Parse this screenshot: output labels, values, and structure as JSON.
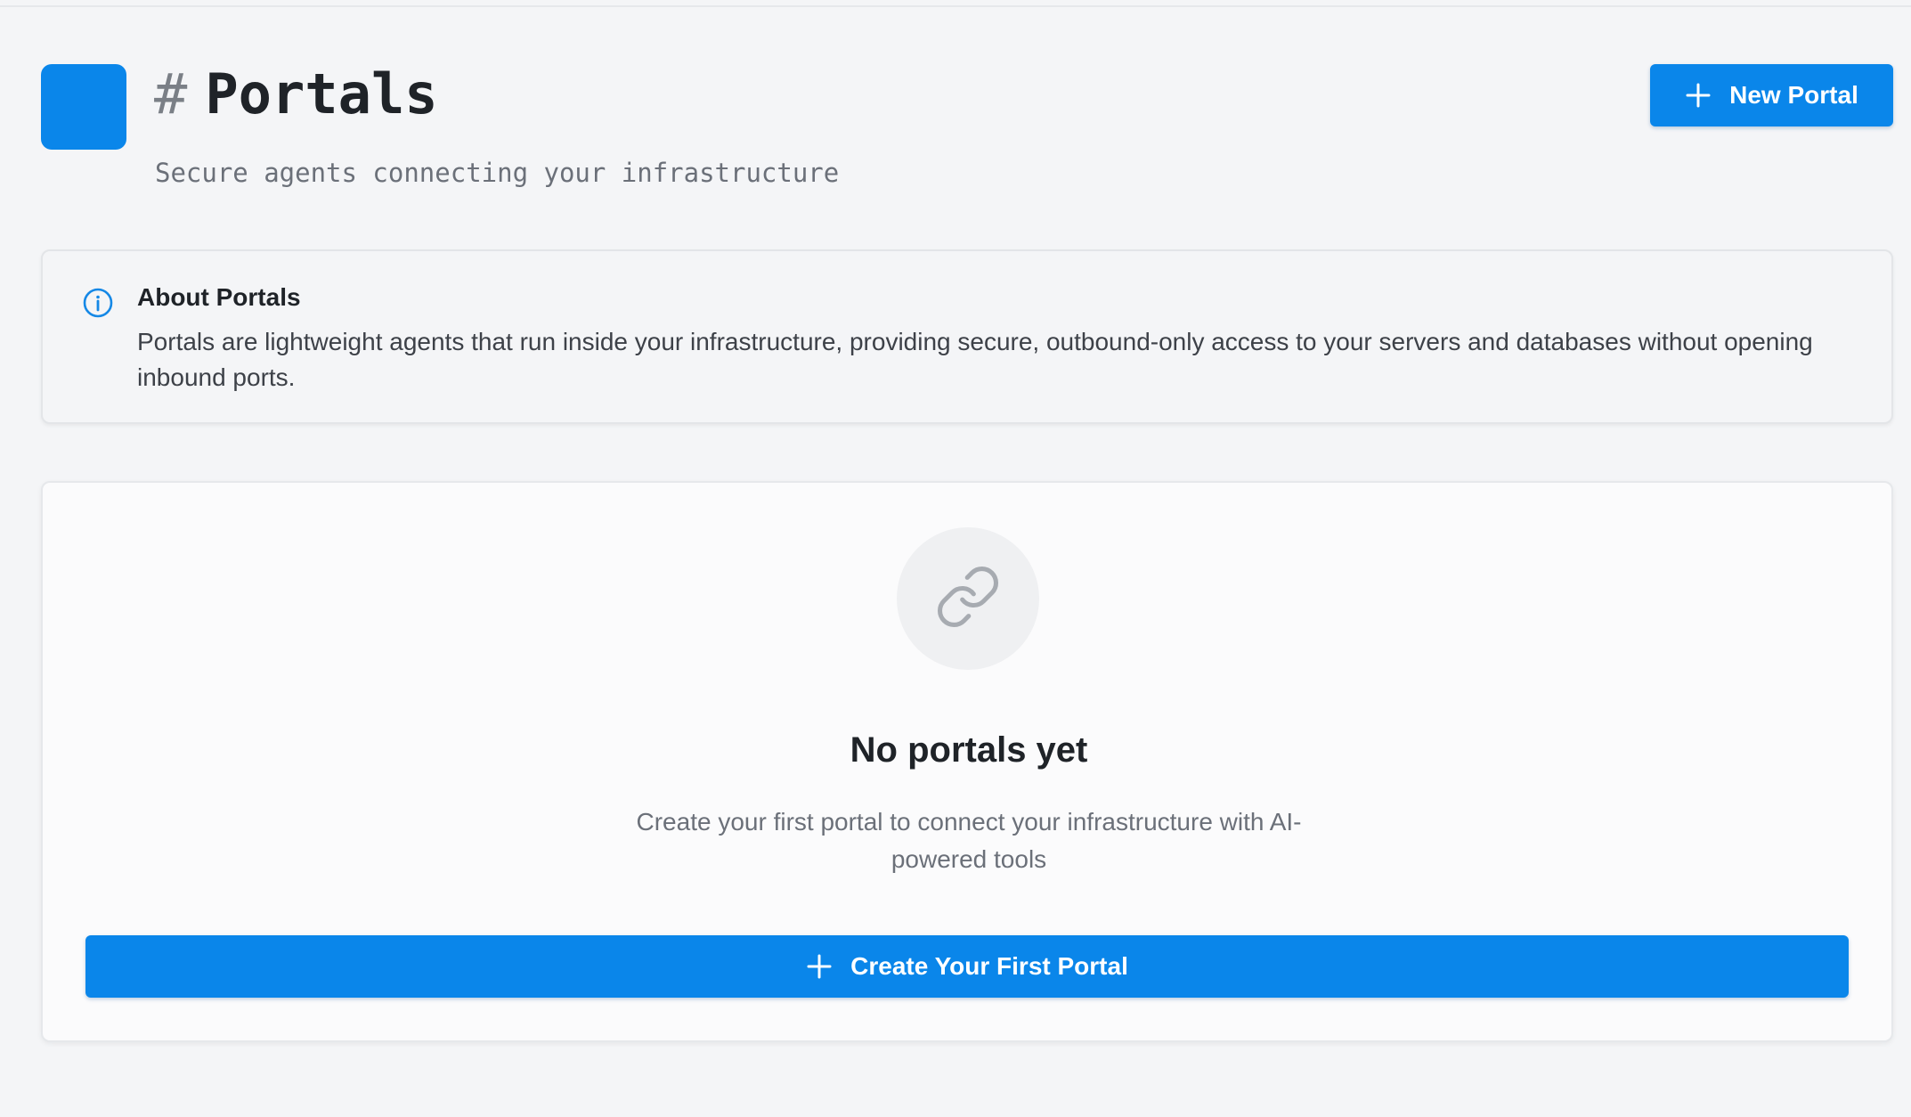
{
  "header": {
    "title_prefix": "#",
    "title": "Portals",
    "subtitle": "Secure agents connecting your infrastructure",
    "new_portal_label": "New Portal"
  },
  "info": {
    "title": "About Portals",
    "text": "Portals are lightweight agents that run inside your infrastructure, providing secure, outbound-only access to your servers and databases without opening inbound ports.",
    "icon": "info-circle-icon"
  },
  "empty_state": {
    "icon": "link-icon",
    "title": "No portals yet",
    "text": "Create your first portal to connect your infrastructure with AI-powered tools",
    "button_label": "Create Your First Portal"
  },
  "colors": {
    "accent": "#0a86ea",
    "background": "#f4f5f7",
    "card": "#fbfbfc",
    "text_muted": "#6b7079"
  }
}
